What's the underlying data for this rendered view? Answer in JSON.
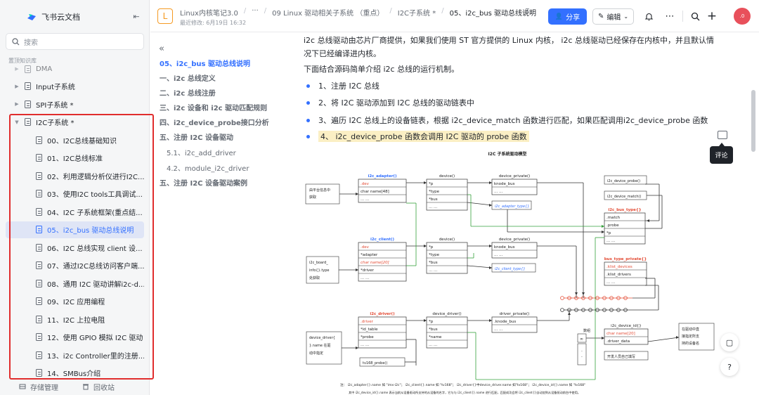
{
  "sidebar": {
    "brand": "飞书云文档",
    "search_placeholder": "搜索",
    "section_label": "置顶知识库",
    "items": [
      {
        "label": "DMA",
        "level": 1
      },
      {
        "label": "Input子系统",
        "level": 1
      },
      {
        "label": "SPI子系统 *",
        "level": 1
      },
      {
        "label": "I2C子系统 *",
        "level": 1,
        "expanded": true
      },
      {
        "label": "00、I2C总线基础知识",
        "level": 2
      },
      {
        "label": "01、I2C总线标准",
        "level": 2
      },
      {
        "label": "02、利用逻辑分析仪进行I2C...",
        "level": 2
      },
      {
        "label": "03、使用I2C tools工具调试...",
        "level": 2
      },
      {
        "label": "04、I2C 子系统框架(重点结...",
        "level": 2
      },
      {
        "label": "05、i2c_bus 驱动总线说明",
        "level": 2,
        "active": true
      },
      {
        "label": "06、I2C 总线实现 client 设...",
        "level": 2
      },
      {
        "label": "07、通过I2C总线访问客户端...",
        "level": 2
      },
      {
        "label": "08、通用 I2C 驱动讲解i2c-d...",
        "level": 2
      },
      {
        "label": "09、I2C 应用编程",
        "level": 2
      },
      {
        "label": "11、I2C 上拉电阻",
        "level": 2
      },
      {
        "label": "12、使用 GPIO 模拟 I2C 驱动",
        "level": 2
      },
      {
        "label": "13、i2c Controller里的注册...",
        "level": 2
      },
      {
        "label": "14、SMBus介绍",
        "level": 2
      }
    ],
    "bottom": {
      "storage": "存储管理",
      "trash": "回收站"
    }
  },
  "header": {
    "logo_letter": "L",
    "breadcrumb": [
      "Linux内核笔记3.0",
      "···",
      "09 Linux 驱动相关子系统 （重点）",
      "I2C子系统 *",
      "05、i2c_bus 驱动总线说明"
    ],
    "edit_time": "最近修改: 6月19日 16:32",
    "share_label": "分享",
    "edit_label": "编辑",
    "avatar_text": ".0"
  },
  "toc": {
    "items": [
      {
        "label": "05、i2c_bus 驱动总线说明",
        "active": true
      },
      {
        "label": "一、i2c 总线定义"
      },
      {
        "label": "二、i2c 总线注册"
      },
      {
        "label": "三、i2c 设备和 i2c 驱动匹配规则"
      },
      {
        "label": "四、i2c_device_probe接口分析"
      },
      {
        "label": "五、注册 I2C 设备驱动"
      },
      {
        "label": "5.1、i2c_add_driver",
        "sub": true
      },
      {
        "label": "4.2、module_i2c_driver",
        "sub": true
      },
      {
        "label": "五、注册 I2C 设备驱动案例"
      }
    ]
  },
  "content": {
    "para1": "i2c 总线驱动由芯片厂商提供，如果我们使用 ST 官方提供的 Linux 内核， i2c 总线驱动已经保存在内核中，并且默认情况下已经编译进内核。",
    "para2": "下面结合源码简单介绍 i2c 总线的运行机制。",
    "bullets": [
      "1、注册 I2C 总线",
      "2、将 I2C 驱动添加到 I2C 总线的驱动链表中",
      "3、遍历 I2C 总线上的设备链表，根据 i2c_device_match 函数进行匹配，如果匹配调用i2c_device_probe 函数",
      "4、 i2c_device_probe 函数会调用 I2C 驱动的 probe 函数"
    ]
  },
  "diagram": {
    "title": "I2C 子系统驱动模型",
    "adapter": {
      "title": "i2c_adapter()",
      "fields": [
        ".dev",
        "char name[48]",
        "... ..."
      ]
    },
    "client": {
      "title": "i2c_client()",
      "fields": [
        ".dev",
        "*adapter",
        "char name[20]",
        "*driver",
        "... ..."
      ]
    },
    "driver": {
      "title": "i2c_driver()",
      "fields": [
        ".driver",
        "*id_table",
        "*probe",
        "... ..."
      ]
    },
    "device1": {
      "title": "device()",
      "fields": [
        "*p",
        "*type",
        "*bus",
        "... ..."
      ]
    },
    "device2": {
      "title": "device()",
      "fields": [
        "*p",
        "*type",
        "*bus",
        "... ..."
      ]
    },
    "device_driver": {
      "title": "device_driver()",
      "fields": [
        "*p",
        "*bus",
        "*name",
        "... ..."
      ]
    },
    "device_private1": {
      "title": "device_private()",
      "fields": [
        "knode_bus",
        "... ..."
      ]
    },
    "device_private2": {
      "title": "device_private()",
      "fields": [
        "knode_bus",
        "... ..."
      ]
    },
    "driver_private": {
      "title": "driver_private()",
      "fields": [
        ".knode_bus",
        "... ..."
      ]
    },
    "adapter_type": "i2c_adapter_type{}",
    "client_type": "i2c_client_type{}",
    "device_probe": "i2c_device_probe()",
    "device_match": "i2c_device_match()",
    "bus_type": {
      "title": "i2c_bus_type{}",
      "fields": [
        ".match",
        ".probe",
        "*p",
        "... ..."
      ]
    },
    "bus_type_private": {
      "title": "bus_type_private{}",
      "fields": [
        ".klist_devices",
        ".klist_drivers",
        "... ..."
      ]
    },
    "device_id": {
      "title": "i2c_device_id{}",
      "fields": [
        "char name[20]",
        ".driver_data"
      ],
      "note": "开发人员自己填写"
    },
    "array_label": "数组",
    "array_cells": [
      "0",
      "∞"
    ],
    "note_platform": "由平台信息中获取",
    "note_board": "i2c_board_info{}.type 处获取",
    "note_driver": "device_driver{}.name 在驱动中指定",
    "note_right": "在驱动中直接指定所支持的设备名",
    "probe_fn": "tv168_probe()",
    "footnote1": "注： i2c_adapter{}.name 如 \"imx-i2c\"； i2c_client{}.name 如 \"tv168\"； i2c_driver{}中device_driver.name 如\"tv168\"； i2c_device_id{}.name 如 \"tv168\"",
    "footnote2": "其中 i2c_device_id{}.name 表示当前从设备驱动所支持的从设备的名字，它与与 i2c_client{}.name 进行匹配，匹配成功会将 i2c_client{}自动加到从设备驱动前台中使用。"
  },
  "right_rail": {
    "tooltip": "评论"
  },
  "colors": {
    "accent": "#3370ff",
    "highlight_box": "#e02d2d",
    "diagram_green": "#35a03b",
    "diagram_red": "#e34a33"
  }
}
